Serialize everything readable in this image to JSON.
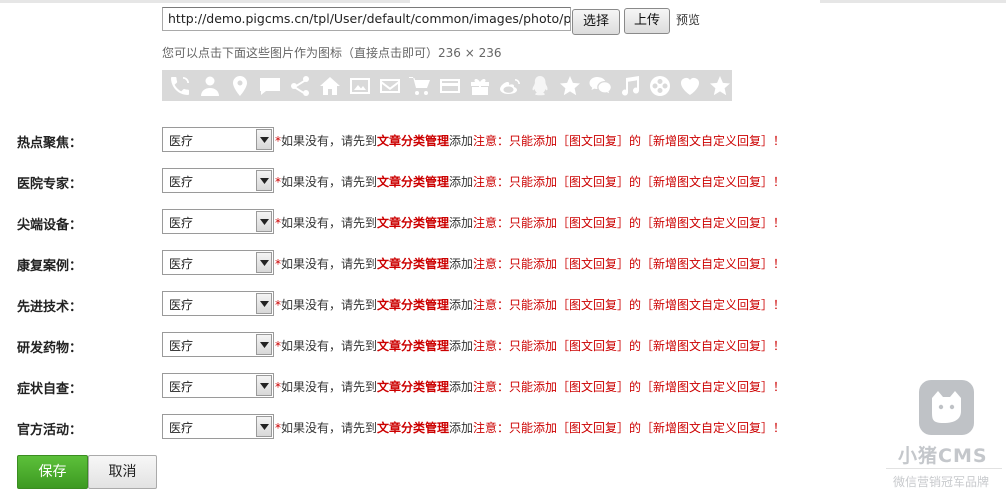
{
  "image_source": {
    "url_value": "http://demo.pigcms.cn/tpl/User/default/common/images/photo/plug",
    "choose_label": "选择",
    "upload_label": "上传",
    "preview_label": "预览"
  },
  "icon_hint": "您可以点击下面这些图片作为图标（直接点击即可）236 × 236",
  "icon_strip": {
    "background_color": "#d9d9d9",
    "icons": [
      "phone-icon",
      "person-icon",
      "location-pin-icon",
      "chat-bubble-icon",
      "share-icon",
      "home-icon",
      "picture-icon",
      "mail-icon",
      "shopping-cart-icon",
      "credit-card-icon",
      "gift-icon",
      "weibo-icon",
      "qq-icon",
      "star-outline-icon",
      "wechat-icon",
      "music-note-icon",
      "film-reel-icon",
      "heart-icon",
      "star-icon"
    ]
  },
  "fields": [
    {
      "label": "热点聚焦：",
      "value": "医疗"
    },
    {
      "label": "医院专家：",
      "value": "医疗"
    },
    {
      "label": "尖端设备：",
      "value": "医疗"
    },
    {
      "label": "康复案例：",
      "value": "医疗"
    },
    {
      "label": "先进技术：",
      "value": "医疗"
    },
    {
      "label": "研发药物：",
      "value": "医疗"
    },
    {
      "label": "症状自查：",
      "value": "医疗"
    },
    {
      "label": "官方活动：",
      "value": "医疗"
    }
  ],
  "field_note": {
    "star": "*",
    "before": "如果没有，请先到",
    "link": "文章分类管理",
    "after": "添加",
    "warning": "注意：只能添加［图文回复］的［新增图文自定义回复］！"
  },
  "actions": {
    "save_label": "保存",
    "cancel_label": "取消"
  },
  "watermark": {
    "name": "小猪CMS",
    "slogan": "微信营销冠军品牌"
  },
  "colors": {
    "accent_green": "#4caf2d",
    "warning_red": "#cc0000"
  }
}
